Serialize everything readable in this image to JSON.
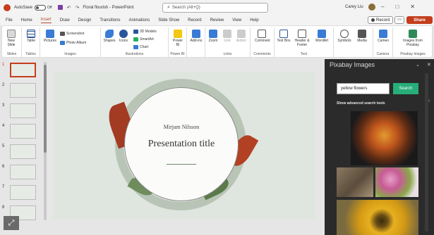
{
  "titlebar": {
    "autosave_label": "AutoSave",
    "autosave_state": "Off",
    "file_title": "Floral flourish - PowerPoint",
    "search_placeholder": "Search (Alt+Q)",
    "user_name": "Carey Liu",
    "qat_icons": [
      "undo-icon",
      "redo-icon",
      "customize-icon"
    ],
    "window_controls": [
      "minimize",
      "maximize",
      "close"
    ]
  },
  "menu": {
    "tabs": [
      "File",
      "Home",
      "Insert",
      "Draw",
      "Design",
      "Transitions",
      "Animations",
      "Slide Show",
      "Record",
      "Review",
      "View",
      "Help"
    ],
    "active_tab": "Insert",
    "record_label": "Record",
    "share_label": "Share"
  },
  "ribbon": {
    "groups": [
      {
        "label": "Slides",
        "buttons": [
          "New Slide"
        ]
      },
      {
        "label": "Tables",
        "buttons": [
          "Table"
        ]
      },
      {
        "label": "Images",
        "buttons": [
          "Pictures"
        ],
        "small": [
          "Screenshot",
          "Photo Album"
        ]
      },
      {
        "label": "Illustrations",
        "buttons": [
          "Shapes",
          "Icons"
        ],
        "small": [
          "3D Models",
          "SmartArt",
          "Chart"
        ]
      },
      {
        "label": "Power BI",
        "buttons": [
          "Power BI"
        ]
      },
      {
        "label": "",
        "buttons": [
          "Add-ins"
        ]
      },
      {
        "label": "Links",
        "buttons": [
          "Zoom",
          "Link",
          "Action"
        ]
      },
      {
        "label": "Comments",
        "buttons": [
          "Comment"
        ]
      },
      {
        "label": "Text",
        "buttons": [
          "Text Box",
          "Header & Footer",
          "WordArt"
        ]
      },
      {
        "label": "",
        "buttons": [
          "Symbols",
          "Media"
        ]
      },
      {
        "label": "Camera",
        "buttons": [
          "Cameo"
        ]
      },
      {
        "label": "Pixabay Images",
        "buttons": [
          "Images from Pixabay"
        ]
      }
    ]
  },
  "thumbnails": {
    "numbers": [
      "1",
      "2",
      "3",
      "4",
      "5",
      "6",
      "7",
      "8"
    ],
    "selected": "1"
  },
  "slide": {
    "author": "Mirjam Nilsson",
    "title": "Presentation title"
  },
  "pane": {
    "title": "Pixabay Images",
    "search_value": "yellow flowers",
    "search_button": "Search",
    "advanced_link": "Show advanced search tools",
    "results": [
      "orange-rose-image",
      "dry-flower-image",
      "pink-flowers-bird-image",
      "sunflower-image"
    ]
  },
  "colors": {
    "accent": "#c43e1c",
    "pane_bg": "#2b2b2b",
    "search_button": "#27ae79"
  }
}
